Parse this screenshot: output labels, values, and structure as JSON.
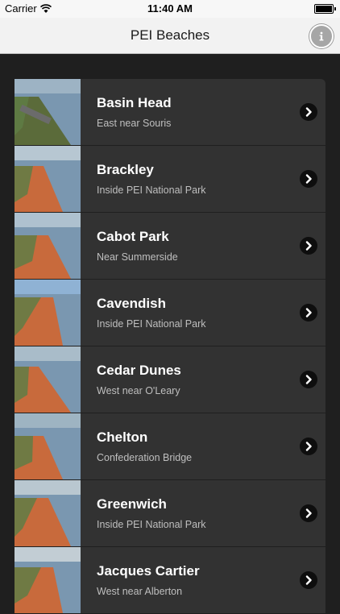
{
  "status_bar": {
    "carrier": "Carrier",
    "time": "11:40 AM"
  },
  "nav": {
    "title": "PEI Beaches",
    "info_icon": "info-icon"
  },
  "beaches": [
    {
      "name": "Basin Head",
      "subtitle": "East near Souris"
    },
    {
      "name": "Brackley",
      "subtitle": "Inside PEI National Park"
    },
    {
      "name": "Cabot Park",
      "subtitle": "Near Summerside"
    },
    {
      "name": "Cavendish",
      "subtitle": "Inside PEI National Park"
    },
    {
      "name": "Cedar Dunes",
      "subtitle": "West near O'Leary"
    },
    {
      "name": "Chelton",
      "subtitle": "Confederation Bridge"
    },
    {
      "name": "Greenwich",
      "subtitle": "Inside PEI National Park"
    },
    {
      "name": "Jacques Cartier",
      "subtitle": "West near Alberton"
    }
  ],
  "colors": {
    "background": "#1f1f1f",
    "row": "#323232",
    "title_text": "#ffffff",
    "subtitle_text": "#bfbfbf",
    "sand": "#c86a3c",
    "water": "#7a97b0"
  }
}
